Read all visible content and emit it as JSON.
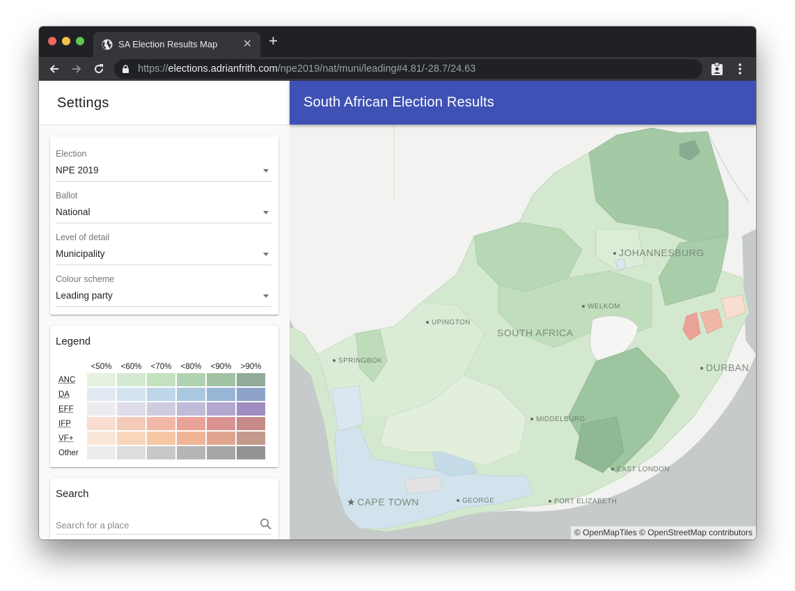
{
  "browser": {
    "tab_title": "SA Election Results Map",
    "tab_icon": "globe-icon",
    "url_scheme": "https://",
    "url_host": "elections.adrianfrith.com",
    "url_path": "/npe2019/nat/muni/leading#4.81/-28.7/24.63"
  },
  "sidebar": {
    "title": "Settings",
    "settings": [
      {
        "label": "Election",
        "value": "NPE 2019"
      },
      {
        "label": "Ballot",
        "value": "National"
      },
      {
        "label": "Level of detail",
        "value": "Municipality"
      },
      {
        "label": "Colour scheme",
        "value": "Leading party"
      }
    ],
    "legend": {
      "title": "Legend",
      "columns": [
        "<50%",
        "<60%",
        "<70%",
        "<80%",
        "<90%",
        ">90%"
      ],
      "rows": [
        {
          "party": "ANC",
          "abbr": true,
          "colors": [
            "#e5f2e0",
            "#d5e9d2",
            "#c4e1c0",
            "#b0d4b1",
            "#a1c3a4",
            "#90ab98"
          ]
        },
        {
          "party": "DA",
          "abbr": true,
          "colors": [
            "#e1eaf3",
            "#d2e3ee",
            "#bed6e9",
            "#abc8e1",
            "#98b5d6",
            "#8ea3c9"
          ]
        },
        {
          "party": "EFF",
          "abbr": true,
          "colors": [
            "#ebebf0",
            "#dfdde9",
            "#cfcce0",
            "#bfbbd9",
            "#b3a6cf",
            "#a08ec2"
          ]
        },
        {
          "party": "IFP",
          "abbr": true,
          "colors": [
            "#f8ddd0",
            "#f4cab9",
            "#f2b8a6",
            "#eba298",
            "#da9393",
            "#c68b88"
          ]
        },
        {
          "party": "VF+",
          "abbr": true,
          "colors": [
            "#fae6d6",
            "#f8d6bc",
            "#f5c7a4",
            "#efb595",
            "#e1a58f",
            "#c39a8b"
          ]
        },
        {
          "party": "Other",
          "abbr": false,
          "colors": [
            "#ececec",
            "#dddddd",
            "#c8c8c8",
            "#b5b5b5",
            "#a6a6a6",
            "#939393"
          ]
        }
      ]
    },
    "search": {
      "title": "Search",
      "placeholder": "Search for a place"
    }
  },
  "main": {
    "title": "South African Election Results",
    "accent_color": "#3f51b5",
    "map": {
      "labels": [
        {
          "text": "JOHANNESBURG",
          "big": true,
          "dot": true
        },
        {
          "text": "WELKOM",
          "big": false,
          "dot": true
        },
        {
          "text": "SOUTH AFRICA",
          "big": true,
          "dot": false
        },
        {
          "text": "UPINGTON",
          "big": false,
          "dot": true
        },
        {
          "text": "SPRINGBOK",
          "big": false,
          "dot": true
        },
        {
          "text": "DURBAN",
          "big": true,
          "dot": true
        },
        {
          "text": "MIDDELBURG",
          "big": false,
          "dot": true
        },
        {
          "text": "EAST LONDON",
          "big": false,
          "dot": true
        },
        {
          "text": "CAPE TOWN",
          "big": true,
          "dot": false
        },
        {
          "text": "GEORGE",
          "big": false,
          "dot": true
        },
        {
          "text": "PORT ELIZABETH",
          "big": false,
          "dot": true
        }
      ],
      "attribution": "© OpenMapTiles © OpenStreetMap contributors"
    }
  }
}
